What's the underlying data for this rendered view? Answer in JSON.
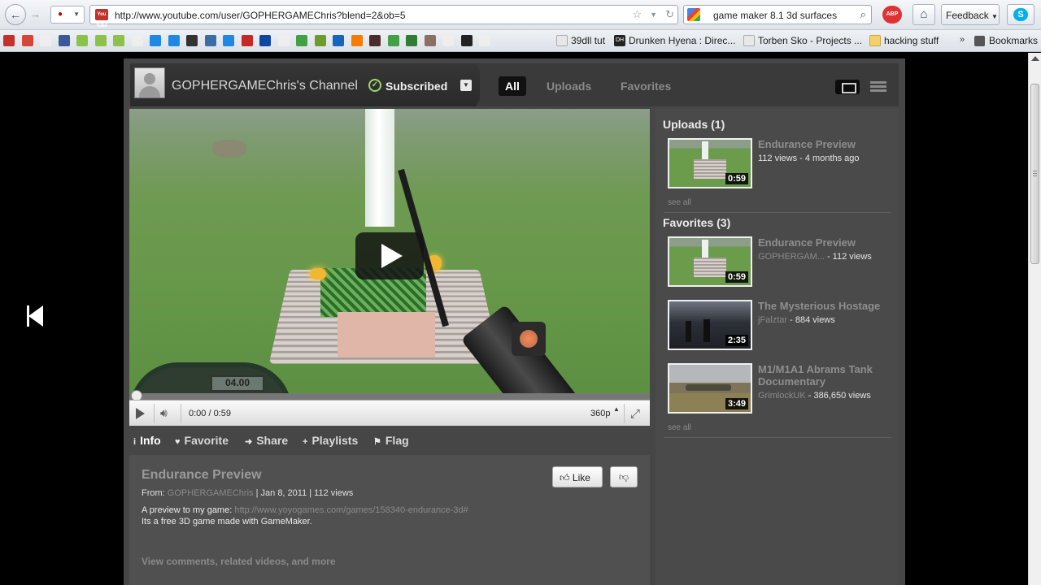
{
  "browser": {
    "url": "http://www.youtube.com/user/GOPHERGAMEChris?blend=2&ob=5",
    "search_query": "game maker 8.1 3d surfaces",
    "feedback_label": "Feedback",
    "youtube_favicon_text": "You Tube",
    "abp_text": "ABP",
    "bookmarks": [
      {
        "label": "39dll tut",
        "icon_color": "#e8e8e8"
      },
      {
        "label": "Drunken Hyena : Direc...",
        "icon_color": "#222222"
      },
      {
        "label": "Torben Sko - Projects ...",
        "icon_color": "#e8e8e8"
      },
      {
        "label": "hacking stuff",
        "icon_color": "#f2d16b"
      }
    ],
    "bookmarks_menu_label": "Bookmarks",
    "bookmark_icon_colors": [
      "#c4302b",
      "#d44638",
      "#eeeeee",
      "#3b5998",
      "#8bc34a",
      "#8bc34a",
      "#8bc34a",
      "#eeeeee",
      "#1e88e5",
      "#1e88e5",
      "#333333",
      "#3a6ea5",
      "#1e88e5",
      "#c62828",
      "#0d47a1",
      "#eeeeee",
      "#43a047",
      "#6d9c2e",
      "#1565c0",
      "#f57c00",
      "#4a2c2a",
      "#43a047",
      "#2e7d32",
      "#8d6e63",
      "#eeeeee",
      "#222222",
      "#eeeeee"
    ]
  },
  "channel": {
    "name": "GOPHERGAMEChris's Channel",
    "subscribed_label": "Subscribed",
    "tabs": [
      "All",
      "Uploads",
      "Favorites"
    ]
  },
  "player": {
    "time": "0:00 / 0:59",
    "quality": "360p",
    "progress_fraction": 0,
    "hud_text": "04.00"
  },
  "actions": [
    {
      "label": "Info",
      "glyph": "i"
    },
    {
      "label": "Favorite",
      "glyph": "♥"
    },
    {
      "label": "Share",
      "glyph": "➜"
    },
    {
      "label": "Playlists",
      "glyph": "+"
    },
    {
      "label": "Flag",
      "glyph": "⚑"
    }
  ],
  "info": {
    "title": "Endurance Preview",
    "from_label": "From:",
    "author": "GOPHERGAMEChris",
    "date_views": "| Jan 8, 2011  | 112 views",
    "desc_prefix": "A preview to my game:",
    "desc_link": "http://www.yoyogames.com/games/158340-endurance-3d#",
    "desc_line2": "Its a free 3D game made with GameMaker.",
    "like_label": "Like",
    "view_comments": "View comments, related videos, and more"
  },
  "sidebar": {
    "uploads": {
      "title": "Uploads (1)",
      "see_all": "see all",
      "items": [
        {
          "title": "Endurance Preview",
          "user": "",
          "meta": "112 views - 4 months ago",
          "duration": "0:59"
        }
      ]
    },
    "favorites": {
      "title": "Favorites (3)",
      "see_all": "see all",
      "items": [
        {
          "title": "Endurance Preview",
          "user": "GOPHERGAM...",
          "meta": " - 112 views",
          "duration": "0:59"
        },
        {
          "title": "The Mysterious Hostage",
          "user": "jFalztar",
          "meta": " - 884 views",
          "duration": "2:35"
        },
        {
          "title": "M1/M1A1 Abrams Tank Documentary",
          "user": "GrimlockUK",
          "meta": " - 386,650 views",
          "duration": "3:49"
        }
      ]
    }
  }
}
